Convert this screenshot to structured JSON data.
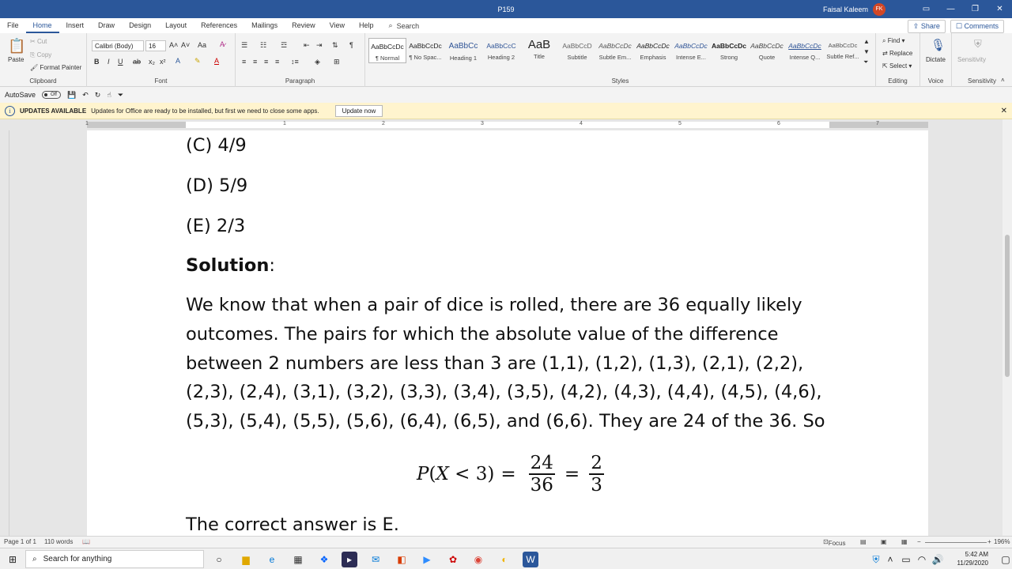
{
  "window": {
    "title": "P159",
    "user_name": "Faisal Kaleem",
    "user_initials": "FK"
  },
  "tabs": [
    {
      "label": "File"
    },
    {
      "label": "Home"
    },
    {
      "label": "Insert"
    },
    {
      "label": "Draw"
    },
    {
      "label": "Design"
    },
    {
      "label": "Layout"
    },
    {
      "label": "References"
    },
    {
      "label": "Mailings"
    },
    {
      "label": "Review"
    },
    {
      "label": "View"
    },
    {
      "label": "Help"
    }
  ],
  "search_label": "Search",
  "share_label": "Share",
  "comments_label": "Comments",
  "ribbon": {
    "clipboard": {
      "paste": "Paste",
      "cut": "Cut",
      "copy": "Copy",
      "format_painter": "Format Painter",
      "label": "Clipboard"
    },
    "font": {
      "name": "Calibri (Body)",
      "size": "16",
      "label": "Font"
    },
    "paragraph": {
      "label": "Paragraph"
    },
    "styles": {
      "label": "Styles",
      "items": [
        {
          "sample": "AaBbCcDc",
          "name": "¶ Normal"
        },
        {
          "sample": "AaBbCcDc",
          "name": "¶ No Spac..."
        },
        {
          "sample": "AaBbCc",
          "name": "Heading 1"
        },
        {
          "sample": "AaBbCcC",
          "name": "Heading 2"
        },
        {
          "sample": "AaB",
          "name": "Title"
        },
        {
          "sample": "AaBbCcD",
          "name": "Subtitle"
        },
        {
          "sample": "AaBbCcDc",
          "name": "Subtle Em..."
        },
        {
          "sample": "AaBbCcDc",
          "name": "Emphasis"
        },
        {
          "sample": "AaBbCcDc",
          "name": "Intense E..."
        },
        {
          "sample": "AaBbCcDc",
          "name": "Strong"
        },
        {
          "sample": "AaBbCcDc",
          "name": "Quote"
        },
        {
          "sample": "AaBbCcDc",
          "name": "Intense Q..."
        },
        {
          "sample": "AaBbCcDc",
          "name": "Subtle Ref..."
        }
      ]
    },
    "editing": {
      "find": "Find",
      "replace": "Replace",
      "select": "Select",
      "label": "Editing"
    },
    "voice": {
      "dictate": "Dictate",
      "label": "Voice"
    },
    "sensitivity": {
      "item": "Sensitivity",
      "label": "Sensitivity"
    }
  },
  "qat": {
    "autosave": "AutoSave",
    "toggle": "Off"
  },
  "update_bar": {
    "title": "UPDATES AVAILABLE",
    "message": "Updates for Office are ready to be installed, but first we need to close some apps.",
    "button": "Update now"
  },
  "ruler_numbers": [
    "1",
    "1",
    "2",
    "3",
    "4",
    "5",
    "6",
    "7"
  ],
  "document": {
    "opt_c": "(C) 4/9",
    "opt_d": "(D) 5/9",
    "opt_e": "(E) 2/3",
    "solution_heading": "Solution",
    "solution_colon": ":",
    "paragraph_lines": [
      "We know that when a pair of dice is rolled, there are 36 equally likely",
      "outcomes.  The pairs for which the absolute value of the difference",
      "between 2 numbers are less than 3 are (1,1), (1,2), (1,3), (2,1), (2,2),",
      "(2,3), (2,4), (3,1), (3,2), (3,3), (3,4), (3,5), (4,2), (4,3), (4,4), (4,5), (4,6),",
      "(5,3), (5,4), (5,5), (5,6), (6,4), (6,5), and (6,6). They are 24 of the 36. So"
    ],
    "equation": {
      "lhs_p": "P",
      "lhs_open": "(",
      "lhs_x": "X",
      "lhs_rest": " < 3)",
      "eq": "=",
      "f1_num": "24",
      "f1_den": "36",
      "f2_num": "2",
      "f2_den": "3"
    },
    "answer": "The correct answer is E."
  },
  "status": {
    "page": "Page 1 of 1",
    "words": "110 words",
    "focus": "Focus",
    "zoom": "196%"
  },
  "taskbar": {
    "search_placeholder": "Search for anything",
    "time": "5:42 AM",
    "date": "11/29/2020"
  },
  "colors": {
    "word_blue": "#2b579a",
    "update_bar": "#fff4ce",
    "avatar": "#d24726"
  }
}
